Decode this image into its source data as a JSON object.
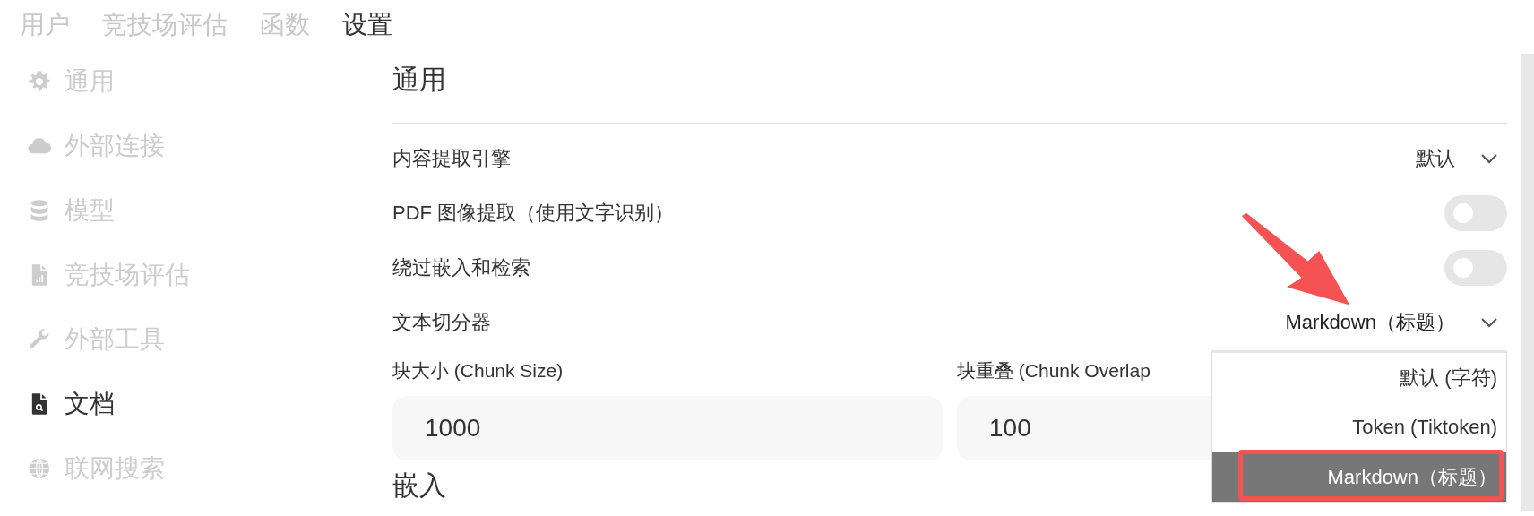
{
  "top_tabs": [
    {
      "label": "用户",
      "selected": false
    },
    {
      "label": "竞技场评估",
      "selected": false
    },
    {
      "label": "函数",
      "selected": false
    },
    {
      "label": "设置",
      "selected": true
    }
  ],
  "sidebar": {
    "items": [
      {
        "label": "通用",
        "kind": "gear",
        "selected": false
      },
      {
        "label": "外部连接",
        "kind": "cloud",
        "selected": false
      },
      {
        "label": "模型",
        "kind": "database",
        "selected": false
      },
      {
        "label": "竞技场评估",
        "kind": "report",
        "selected": false
      },
      {
        "label": "外部工具",
        "kind": "wrench",
        "selected": false
      },
      {
        "label": "文档",
        "kind": "docsearch",
        "selected": true
      },
      {
        "label": "联网搜索",
        "kind": "globe",
        "selected": false
      }
    ]
  },
  "section": {
    "title": "通用",
    "settings": [
      {
        "kind": "select",
        "label": "内容提取引擎",
        "value": "默认",
        "expanded": false
      },
      {
        "kind": "toggle",
        "label": "PDF 图像提取（使用文字识别）",
        "on": false
      },
      {
        "kind": "toggle",
        "label": "绕过嵌入和检索",
        "on": false
      },
      {
        "kind": "select",
        "label": "文本切分器",
        "value": "Markdown（标题）",
        "expanded": true
      }
    ],
    "chunk_fields": [
      {
        "label": "块大小 (Chunk Size)",
        "value": "1000"
      },
      {
        "label": "块重叠 (Chunk Overlap",
        "value": "100"
      }
    ],
    "next_section_title": "嵌入"
  },
  "dropdown_menu": {
    "options": [
      {
        "label": "默认 (字符)",
        "selected": false
      },
      {
        "label": "Token (Tiktoken)",
        "selected": false
      },
      {
        "label": "Markdown（标题）",
        "selected": true
      }
    ]
  }
}
